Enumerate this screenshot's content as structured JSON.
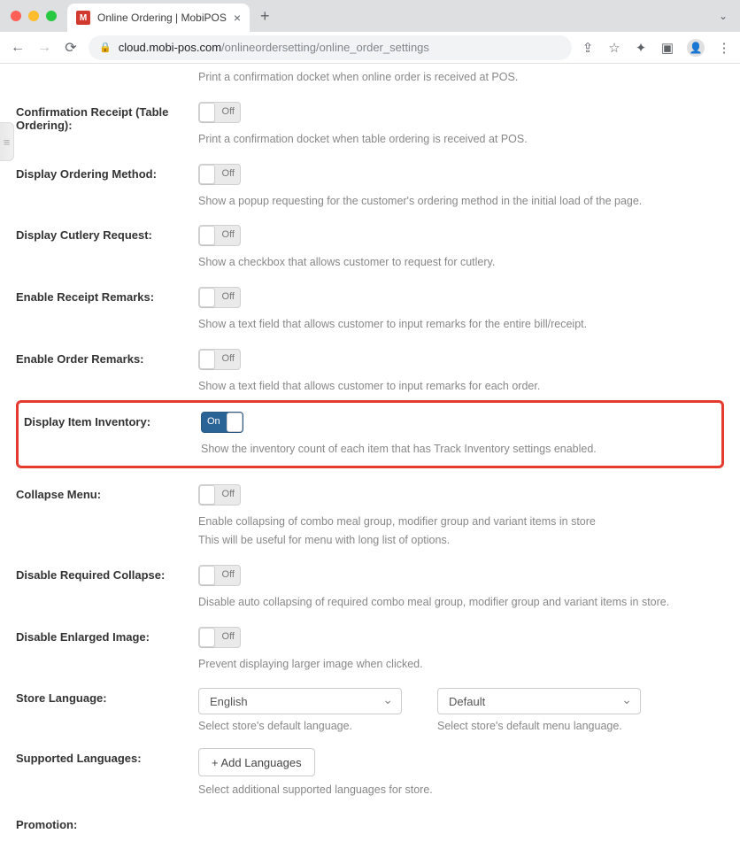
{
  "browser": {
    "tab_title": "Online Ordering | MobiPOS",
    "tab_favicon_letter": "M",
    "url_domain": "cloud.mobi-pos.com",
    "url_path": "/onlineordersetting/online_order_settings"
  },
  "toggle_labels": {
    "on": "On",
    "off": "Off"
  },
  "settings": {
    "top_desc": "Print a confirmation docket when online order is received at POS.",
    "confirmation_receipt": {
      "label": "Confirmation Receipt (Table Ordering):",
      "state": "Off",
      "desc": "Print a confirmation docket when table ordering is received at POS."
    },
    "display_ordering_method": {
      "label": "Display Ordering Method:",
      "state": "Off",
      "desc": "Show a popup requesting for the customer's ordering method in the initial load of the page."
    },
    "display_cutlery_request": {
      "label": "Display Cutlery Request:",
      "state": "Off",
      "desc": "Show a checkbox that allows customer to request for cutlery."
    },
    "enable_receipt_remarks": {
      "label": "Enable Receipt Remarks:",
      "state": "Off",
      "desc": "Show a text field that allows customer to input remarks for the entire bill/receipt."
    },
    "enable_order_remarks": {
      "label": "Enable Order Remarks:",
      "state": "Off",
      "desc": "Show a text field that allows customer to input remarks for each order."
    },
    "display_item_inventory": {
      "label": "Display Item Inventory:",
      "state": "On",
      "desc": "Show the inventory count of each item that has Track Inventory settings enabled."
    },
    "collapse_menu": {
      "label": "Collapse Menu:",
      "state": "Off",
      "desc1": "Enable collapsing of combo meal group, modifier group and variant items in store",
      "desc2": "This will be useful for menu with long list of options."
    },
    "disable_required_collapse": {
      "label": "Disable Required Collapse:",
      "state": "Off",
      "desc": "Disable auto collapsing of required combo meal group, modifier group and variant items in store."
    },
    "disable_enlarged_image": {
      "label": "Disable Enlarged Image:",
      "state": "Off",
      "desc": "Prevent displaying larger image when clicked."
    },
    "store_language": {
      "label": "Store Language:",
      "select1": "English",
      "select2": "Default",
      "desc1": "Select store's default language.",
      "desc2": "Select store's default menu language."
    },
    "supported_languages": {
      "label": "Supported Languages:",
      "button": "+ Add Languages",
      "desc": "Select additional supported languages for store."
    },
    "promotion": {
      "label": "Promotion:"
    }
  }
}
